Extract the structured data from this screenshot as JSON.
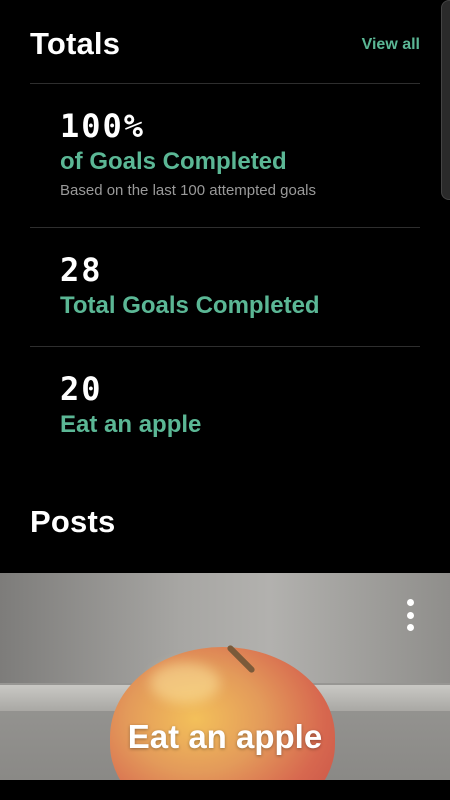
{
  "totals": {
    "title": "Totals",
    "view_all": "View all",
    "stats": [
      {
        "value": "100%",
        "label": "of Goals Completed",
        "sub": "Based on the last 100 attempted goals"
      },
      {
        "value": "28",
        "label": "Total Goals Completed"
      },
      {
        "value": "20",
        "label": "Eat an apple"
      }
    ]
  },
  "posts": {
    "title": "Posts",
    "items": [
      {
        "title": "Eat an apple",
        "menu_icon": "more-vert-icon"
      }
    ]
  },
  "colors": {
    "background": "#000000",
    "accent": "#5bb795",
    "secondary_text": "#9a9a9a",
    "divider": "#2e2e2e"
  }
}
